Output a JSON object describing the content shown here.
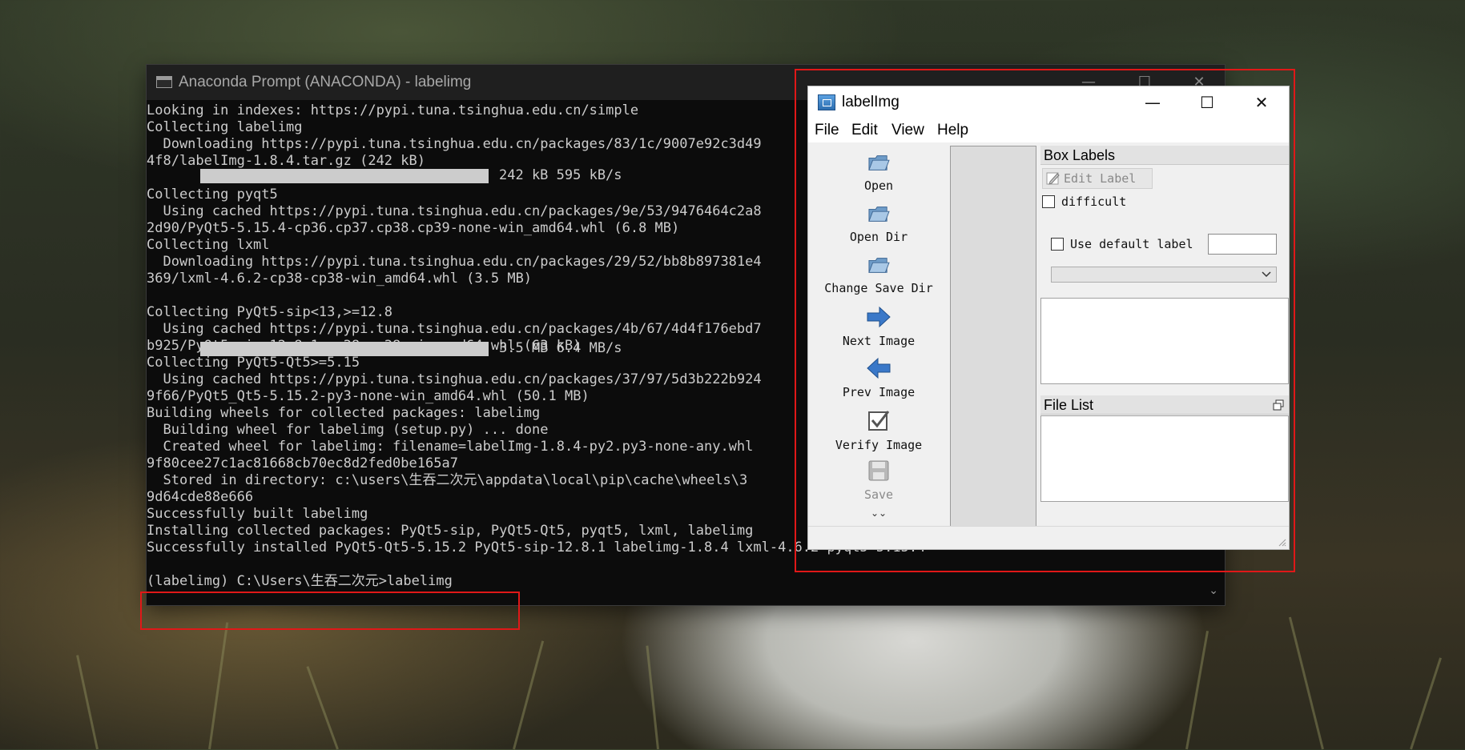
{
  "terminal": {
    "title": "Anaconda Prompt (ANACONDA) - labelimg",
    "controls": {
      "minimize": "—",
      "maximize": "☐",
      "close": "✕"
    },
    "lines": [
      "Looking in indexes: https://pypi.tuna.tsinghua.edu.cn/simple",
      "Collecting labelimg",
      "  Downloading https://pypi.tuna.tsinghua.edu.cn/packages/83/1c/9007e92c3d49",
      "4f8/labelImg-1.8.4.tar.gz (242 kB)",
      "",
      "Collecting pyqt5",
      "  Using cached https://pypi.tuna.tsinghua.edu.cn/packages/9e/53/9476464c2a8",
      "2d90/PyQt5-5.15.4-cp36.cp37.cp38.cp39-none-win_amd64.whl (6.8 MB)",
      "Collecting lxml",
      "  Downloading https://pypi.tuna.tsinghua.edu.cn/packages/29/52/bb8b897381e4",
      "369/lxml-4.6.2-cp38-cp38-win_amd64.whl (3.5 MB)",
      "",
      "Collecting PyQt5-sip<13,>=12.8",
      "  Using cached https://pypi.tuna.tsinghua.edu.cn/packages/4b/67/4d4f176ebd7",
      "b925/PyQt5_sip-12.8.1-cp38-cp38-win_amd64.whl (63 kB)",
      "Collecting PyQt5-Qt5>=5.15",
      "  Using cached https://pypi.tuna.tsinghua.edu.cn/packages/37/97/5d3b222b924",
      "9f66/PyQt5_Qt5-5.15.2-py3-none-win_amd64.whl (50.1 MB)",
      "Building wheels for collected packages: labelimg",
      "  Building wheel for labelimg (setup.py) ... done",
      "  Created wheel for labelimg: filename=labelImg-1.8.4-py2.py3-none-any.whl",
      "9f80cee27c1ac81668cb70ec8d2fed0be165a7",
      "  Stored in directory: c:\\users\\生吞二次元\\appdata\\local\\pip\\cache\\wheels\\3",
      "9d64cde88e666",
      "Successfully built labelimg",
      "Installing collected packages: PyQt5-sip, PyQt5-Qt5, pyqt5, lxml, labelimg",
      "Successfully installed PyQt5-Qt5-5.15.2 PyQt5-sip-12.8.1 labelimg-1.8.4 lxml-4.6.2 pyqt5-5.15.4",
      "",
      "(labelimg) C:\\Users\\生吞二次元>labelimg"
    ],
    "progress": [
      {
        "text": "242 kB 595 kB/s",
        "fraction": 1.0
      },
      {
        "text": "3.5 MB 6.4 MB/s",
        "fraction": 1.0
      }
    ],
    "prompt_line": "(labelimg) C:\\Users\\生吞二次元>labelimg"
  },
  "labelimg": {
    "title": "labelImg",
    "controls": {
      "minimize": "—",
      "maximize": "☐",
      "close": "✕"
    },
    "menu": [
      "File",
      "Edit",
      "View",
      "Help"
    ],
    "toolbar": {
      "open": "Open",
      "open_dir": "Open Dir",
      "change_save_dir": "Change Save Dir",
      "next_image": "Next Image",
      "prev_image": "Prev Image",
      "verify_image": "Verify Image",
      "save": "Save",
      "more": "⌄⌄"
    },
    "box_labels": {
      "title": "Box Labels",
      "edit_label": "Edit Label",
      "difficult": "difficult",
      "use_default_label": "Use default label",
      "default_label_value": "",
      "combo_value": ""
    },
    "file_list": {
      "title": "File List"
    }
  },
  "colors": {
    "highlight": "#e01818",
    "terminal_bg": "#0c0c0c",
    "terminal_text": "#cccccc",
    "arrow_blue": "#3a78c8"
  }
}
